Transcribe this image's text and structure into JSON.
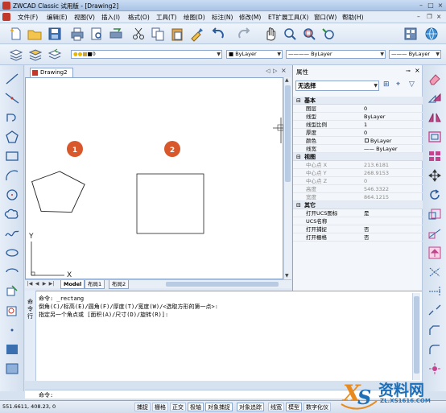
{
  "window": {
    "title": "ZWCAD Classic 试用版 - [Drawing2]"
  },
  "menubar": {
    "items": [
      "文件(F)",
      "编辑(E)",
      "视图(V)",
      "插入(I)",
      "格式(O)",
      "工具(T)",
      "绘图(D)",
      "标注(N)",
      "修改(M)",
      "ET扩展工具(X)",
      "窗口(W)",
      "帮助(H)"
    ]
  },
  "properties_toolbar": {
    "layer": "0",
    "color": "ByLayer",
    "linetype": "ByLayer",
    "lineweight": "ByLayer"
  },
  "document": {
    "tab": "Drawing2"
  },
  "drawing": {
    "marker1": "1",
    "marker2": "2",
    "axis_y": "Y",
    "axis_x": "X",
    "marker_color": "#d9582b"
  },
  "layout_tabs": [
    "Model",
    "布局1",
    "布局2"
  ],
  "properties_panel": {
    "title": "属性",
    "selection": "无选择",
    "categories": [
      {
        "name": "基本",
        "rows": [
          {
            "label": "图层",
            "value": "0",
            "grey": false
          },
          {
            "label": "线型",
            "value": "ByLayer",
            "grey": false
          },
          {
            "label": "线型比例",
            "value": "1",
            "grey": false
          },
          {
            "label": "厚度",
            "value": "0",
            "grey": false
          },
          {
            "label": "颜色",
            "value": "ByLayer",
            "grey": false
          },
          {
            "label": "线宽",
            "value": "—— ByLayer",
            "grey": false
          }
        ]
      },
      {
        "name": "视图",
        "rows": [
          {
            "label": "中心点 X",
            "value": "213.6181",
            "grey": true
          },
          {
            "label": "中心点 Y",
            "value": "268.9153",
            "grey": true
          },
          {
            "label": "中心点 Z",
            "value": "0",
            "grey": true
          },
          {
            "label": "高度",
            "value": "546.3322",
            "grey": true
          },
          {
            "label": "宽度",
            "value": "864.1215",
            "grey": true
          }
        ]
      },
      {
        "name": "其它",
        "rows": [
          {
            "label": "打开UCS图标",
            "value": "是",
            "grey": false
          },
          {
            "label": "UCS名称",
            "value": "",
            "grey": false
          },
          {
            "label": "打开捕捉",
            "value": "否",
            "grey": false
          },
          {
            "label": "打开栅格",
            "value": "否",
            "grey": false
          }
        ]
      }
    ]
  },
  "command": {
    "side_label": "命令行",
    "lines": [
      "命令: _rectang",
      "倒角(C)/标高(E)/圆角(F)/厚度(T)/宽度(W)/<选取方形的第一点>:",
      "指定另一个角点或 [面积(A)/尺寸(D)/旋转(R)]:"
    ],
    "prompt": "命令:"
  },
  "statusbar": {
    "coords": "551.6611,  408.23,  0",
    "buttons": [
      "捕捉",
      "栅格",
      "正交",
      "极轴",
      "对象捕捉",
      "对象追踪",
      "线宽",
      "模型",
      "数字化仪"
    ]
  },
  "watermark": {
    "text": "资料网",
    "url": "ZL.XS1616.COM"
  }
}
